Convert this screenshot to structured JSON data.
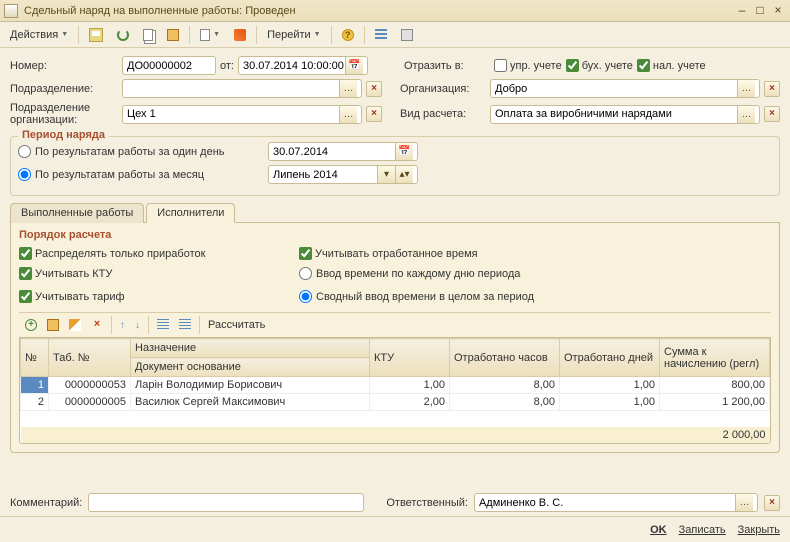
{
  "window": {
    "title": "Сдельный наряд на выполненные работы: Проведен"
  },
  "toolbar": {
    "actions": "Действия",
    "goto": "Перейти"
  },
  "header": {
    "number_label": "Номер:",
    "number_value": "ДО00000002",
    "date_label": "от:",
    "date_value": "30.07.2014 10:00:00",
    "reflect_label": "Отразить в:",
    "chk_upr": "упр. учете",
    "chk_buh": "бух. учете",
    "chk_nal": "нал. учете",
    "subdiv_label": "Подразделение:",
    "subdiv_value": "",
    "org_label": "Организация:",
    "org_value": "Добро",
    "subdiv_org_label": "Подразделение организации:",
    "subdiv_org_value": "Цех 1",
    "calc_type_label": "Вид расчета:",
    "calc_type_value": "Оплата за виробничими нарядами"
  },
  "period": {
    "legend": "Период наряда",
    "opt_day": "По результатам работы за один день",
    "opt_month": "По результатам работы за месяц",
    "day_value": "30.07.2014",
    "month_value": "Липень 2014"
  },
  "tabs": {
    "works": "Выполненные работы",
    "performers": "Исполнители"
  },
  "calc": {
    "title": "Порядок расчета",
    "chk_only_extra": "Распределять только приработок",
    "chk_ktu": "Учитывать КТУ",
    "chk_tariff": "Учитывать тариф",
    "chk_worked_time": "Учитывать отработанное время",
    "opt_per_day": "Ввод времени по каждому дню периода",
    "opt_summary": "Сводный ввод времени в целом за период",
    "btn_calc": "Рассчитать"
  },
  "grid": {
    "columns": {
      "num": "№",
      "tab_num": "Таб. №",
      "assignment": "Назначение",
      "doc_basis": "Документ основание",
      "ktu": "КТУ",
      "hours": "Отработано часов",
      "days": "Отработано дней",
      "sum": "Сумма к начислению (регл)"
    },
    "rows": [
      {
        "num": "1",
        "tab_num": "0000000053",
        "name": "Ларін Володимир Борисович",
        "ktu": "1,00",
        "hours": "8,00",
        "days": "1,00",
        "sum": "800,00"
      },
      {
        "num": "2",
        "tab_num": "0000000005",
        "name": "Василюк Сергей Максимович",
        "ktu": "2,00",
        "hours": "8,00",
        "days": "1,00",
        "sum": "1 200,00"
      }
    ],
    "total": "2 000,00"
  },
  "footer": {
    "comment_label": "Комментарий:",
    "comment_value": "",
    "resp_label": "Ответственный:",
    "resp_value": "Админенко В. С.",
    "ok": "OK",
    "save": "Записать",
    "close": "Закрыть"
  }
}
